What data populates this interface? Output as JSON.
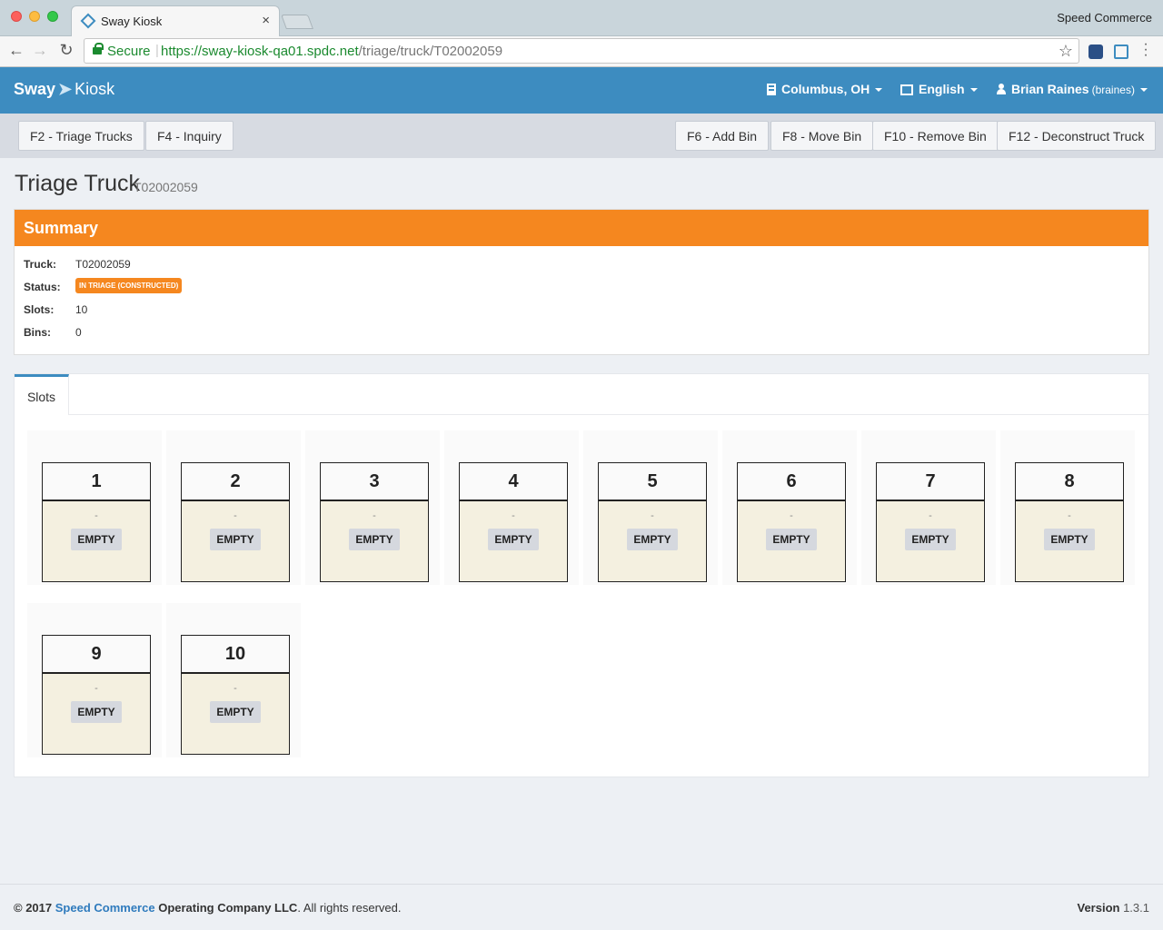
{
  "browser": {
    "tab_title": "Sway Kiosk",
    "tab_close": "×",
    "profile_name": "Speed Commerce",
    "secure_label": "Secure",
    "url_scheme": "https://",
    "url_host": "sway-kiosk-qa01.spdc.net",
    "url_path": "/triage/truck/T02002059"
  },
  "app": {
    "brand_sway": "Sway",
    "brand_kiosk": "Kiosk",
    "location": "Columbus, OH",
    "language": "English",
    "user_name": "Brian Raines",
    "user_login": "(braines)"
  },
  "actions": {
    "triage_trucks": "F2 - Triage Trucks",
    "inquiry": "F4 - Inquiry",
    "add_bin": "F6 - Add Bin",
    "move_bin": "F8 - Move Bin",
    "remove_bin": "F10 - Remove Bin",
    "deconstruct_truck": "F12 - Deconstruct Truck"
  },
  "page": {
    "title": "Triage Truck",
    "subtitle": "T02002059"
  },
  "summary": {
    "heading": "Summary",
    "truck_label": "Truck:",
    "truck_value": "T02002059",
    "status_label": "Status:",
    "status_value": "IN TRIAGE (CONSTRUCTED)",
    "slots_label": "Slots:",
    "slots_value": "10",
    "bins_label": "Bins:",
    "bins_value": "0",
    "status_color": "#f5871f"
  },
  "slots_tab": "Slots",
  "slots": [
    {
      "number": "1",
      "bin": "-",
      "state": "EMPTY"
    },
    {
      "number": "2",
      "bin": "-",
      "state": "EMPTY"
    },
    {
      "number": "3",
      "bin": "-",
      "state": "EMPTY"
    },
    {
      "number": "4",
      "bin": "-",
      "state": "EMPTY"
    },
    {
      "number": "5",
      "bin": "-",
      "state": "EMPTY"
    },
    {
      "number": "6",
      "bin": "-",
      "state": "EMPTY"
    },
    {
      "number": "7",
      "bin": "-",
      "state": "EMPTY"
    },
    {
      "number": "8",
      "bin": "-",
      "state": "EMPTY"
    },
    {
      "number": "9",
      "bin": "-",
      "state": "EMPTY"
    },
    {
      "number": "10",
      "bin": "-",
      "state": "EMPTY"
    }
  ],
  "footer": {
    "copyright_prefix": "© 2017",
    "company_link": "Speed Commerce",
    "company_suffix": "Operating Company LLC",
    "rights": ". All rights reserved.",
    "version_label": "Version",
    "version_value": "1.3.1"
  },
  "colors": {
    "appbar": "#3d8cc0",
    "summary_header": "#f5871f",
    "slot_body": "#f4f0e0"
  }
}
